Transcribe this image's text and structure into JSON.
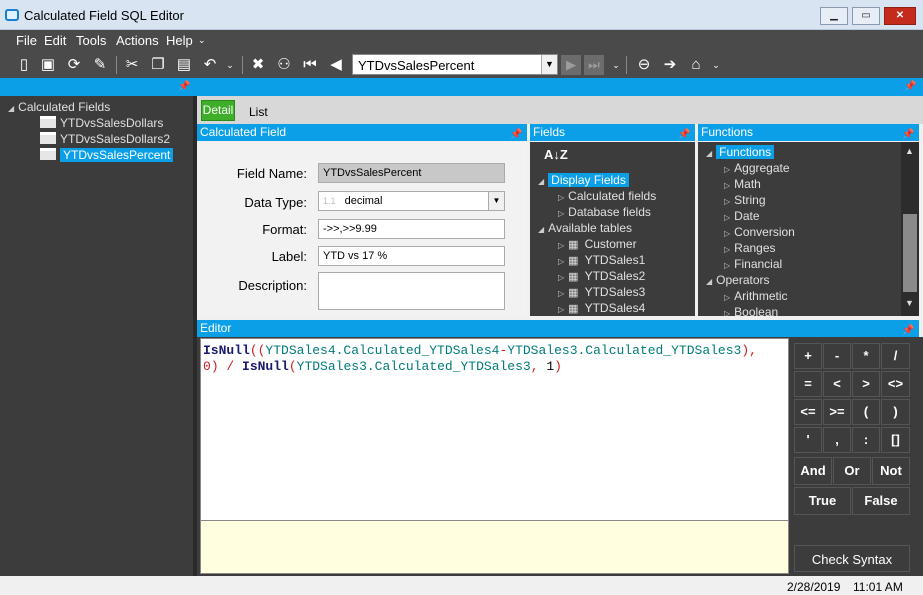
{
  "window": {
    "title": "Calculated Field SQL Editor",
    "min": "▁",
    "max": "▭",
    "close": "✕"
  },
  "menu": [
    "File",
    "Edit",
    "Tools",
    "Actions",
    "Help"
  ],
  "toolbar": {
    "record": "YTDvsSalesPercent"
  },
  "left_tree": {
    "root": "Calculated Fields",
    "items": [
      "YTDvsSalesDollars",
      "YTDvsSalesDollars2",
      "YTDvsSalesPercent"
    ],
    "selected": 2
  },
  "tabs": {
    "detail": "Detail",
    "list": "List"
  },
  "calc_field": {
    "header": "Calculated Field",
    "field_name_label": "Field Name:",
    "field_name": "YTDvsSalesPercent",
    "data_type_label": "Data Type:",
    "data_type_prefix": "1.1",
    "data_type": "decimal",
    "format_label": "Format:",
    "format": "->>,>>9.99",
    "label_label": "Label:",
    "label": "YTD vs 17 %",
    "description_label": "Description:",
    "description": ""
  },
  "fields": {
    "header": "Fields",
    "sort": "A↓Z",
    "display_fields": "Display Fields",
    "calculated_fields": "Calculated fields",
    "database_fields": "Database fields",
    "available_tables": "Available tables",
    "tables": [
      "Customer",
      "YTDSales1",
      "YTDSales2",
      "YTDSales3",
      "YTDSales4"
    ]
  },
  "functions": {
    "header": "Functions",
    "root": "Functions",
    "items": [
      "Aggregate",
      "Math",
      "String",
      "Date",
      "Conversion",
      "Ranges",
      "Financial"
    ],
    "operators": "Operators",
    "operator_items": [
      "Arithmetic",
      "Boolean"
    ]
  },
  "editor": {
    "header": "Editor",
    "line1": {
      "fn": "IsNull",
      "a": "((",
      "f1": "YTDSales4.Calculated_YTDSales4",
      "op": "-",
      "f2": "YTDSales3.Calculated_YTDSales3",
      "b": "),"
    },
    "line2": {
      "zero": "0",
      "c": ")",
      "div": " / ",
      "fn": "IsNull",
      "d": "(",
      "f3": "YTDSales3.Calculated_YTDSales3",
      "e": ", ",
      "one": "1",
      "f": ")"
    }
  },
  "keypad": {
    "row1": [
      "+",
      "-",
      "*",
      "/"
    ],
    "row2": [
      "=",
      "<",
      ">",
      "<>"
    ],
    "row3": [
      "<=",
      ">=",
      "(",
      ")"
    ],
    "row4": [
      "'",
      ",",
      ":",
      "[]"
    ],
    "row5": [
      "And",
      "Or",
      "Not"
    ],
    "row6": [
      "True",
      "False"
    ]
  },
  "check_syntax": "Check Syntax",
  "status": {
    "date": "2/28/2019",
    "time": "11:01 AM"
  },
  "colors": {
    "accent": "#0a9fe6",
    "dark": "#3c3c3c",
    "tab_active": "#3fae2a"
  }
}
